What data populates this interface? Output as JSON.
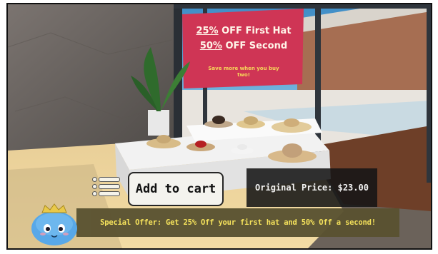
{
  "sign": {
    "line1_pct": "25%",
    "line1_rest": " OFF First Hat",
    "line2_pct": "50%",
    "line2_rest": " OFF Second",
    "subline": "Save more when you buy two!"
  },
  "actions": {
    "add_to_cart": "Add to cart"
  },
  "price": {
    "label": "Original Price: $23.00"
  },
  "offer": {
    "text": "Special Offer: Get 25% Off your first hat and 50% Off a second!"
  },
  "icons": {
    "menu": "menu-list-icon",
    "mascot": "blue-slime-mascot-icon"
  },
  "colors": {
    "sign_background": "#cf3555",
    "sign_subtext": "#f6d85a",
    "offer_text": "#f7e45a",
    "offer_bar": "#5a5231",
    "price_panel": "#161616",
    "button_background": "#f4f3ee",
    "mascot_body": "#58a8e8"
  }
}
